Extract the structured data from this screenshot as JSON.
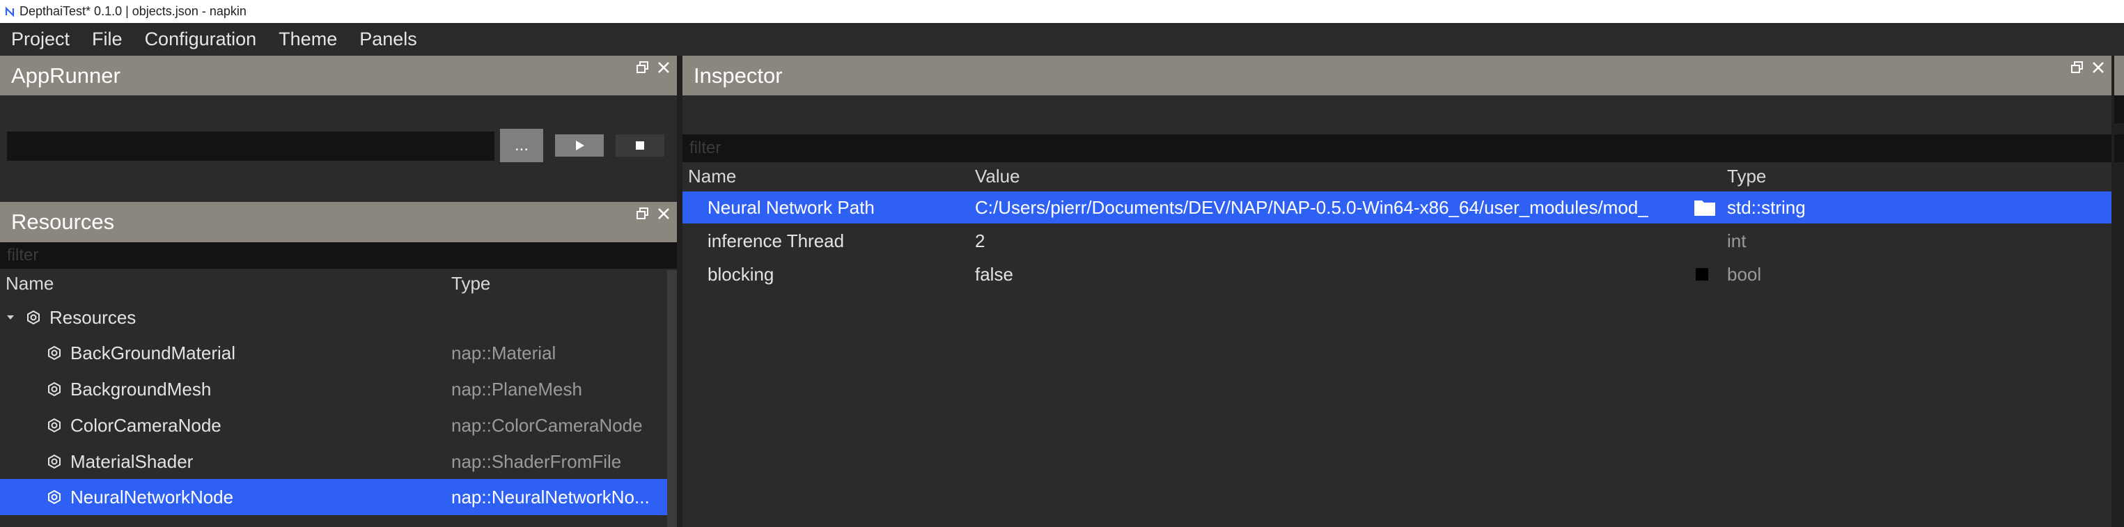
{
  "window": {
    "title": "DepthaiTest* 0.1.0 | objects.json - napkin"
  },
  "menu": [
    "Project",
    "File",
    "Configuration",
    "Theme",
    "Panels"
  ],
  "apprunner": {
    "title": "AppRunner",
    "browse_label": "...",
    "path_value": ""
  },
  "resources": {
    "title": "Resources",
    "filter_placeholder": "filter",
    "col_name": "Name",
    "col_type": "Type",
    "root": {
      "name": "Resources"
    },
    "items": [
      {
        "name": "BackGroundMaterial",
        "type": "nap::Material"
      },
      {
        "name": "BackgroundMesh",
        "type": "nap::PlaneMesh"
      },
      {
        "name": "ColorCameraNode",
        "type": "nap::ColorCameraNode"
      },
      {
        "name": "MaterialShader",
        "type": "nap::ShaderFromFile"
      },
      {
        "name": "NeuralNetworkNode",
        "type": "nap::NeuralNetworkNo..."
      }
    ],
    "selected_index": 4
  },
  "inspector": {
    "title": "Inspector",
    "filter_placeholder": "filter",
    "col_name": "Name",
    "col_value": "Value",
    "col_type": "Type",
    "rows": [
      {
        "name": "Neural Network Path",
        "value": "C:/Users/pierr/Documents/DEV/NAP/NAP-0.5.0-Win64-x86_64/user_modules/mod_",
        "type": "std::string"
      },
      {
        "name": "inference Thread",
        "value": "2",
        "type": "int"
      },
      {
        "name": "blocking",
        "value": "false",
        "type": "bool"
      }
    ]
  },
  "colors": {
    "header": "#8b877e",
    "selection": "#2f60f4",
    "background": "#2b2b2b"
  },
  "icons": [
    "napkin-logo-icon",
    "float-panel-icon",
    "close-icon",
    "play-icon",
    "stop-icon",
    "resource-icon",
    "folder-icon",
    "expand-arrow-icon"
  ]
}
